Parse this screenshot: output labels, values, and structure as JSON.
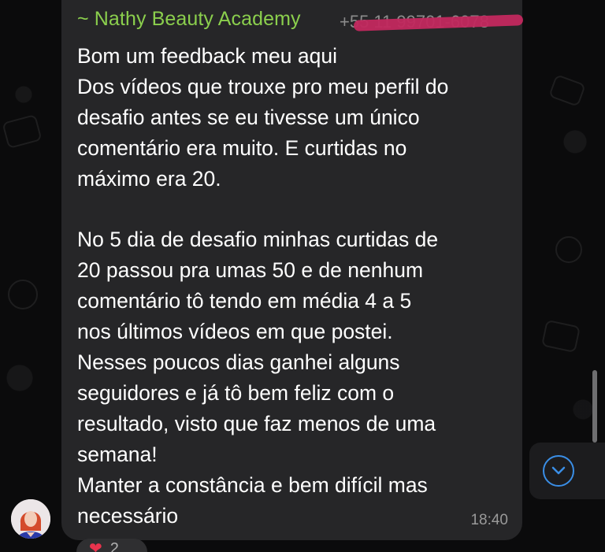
{
  "message": {
    "sender_name": "~ Nathy Beauty Academy",
    "sender_phone": "+55 11 99701-6078",
    "lines": [
      "Bom um feedback meu aqui",
      "Dos vídeos que trouxe pro meu perfil do",
      "desafio antes se eu tivesse um único",
      "comentário era muito. E curtidas no",
      "máximo era 20.",
      "",
      "No 5 dia de desafio minhas curtidas de",
      "20 passou pra umas 50 e de nenhum",
      "comentário tô tendo em média 4 a 5",
      "nos últimos vídeos em que postei.",
      "Nesses poucos dias ganhei alguns",
      "seguidores e já tô bem feliz com o",
      "resultado, visto que faz menos de uma",
      "semana!",
      "Manter a constância e bem difícil mas",
      "necessário"
    ],
    "time": "18:40"
  },
  "reaction": {
    "emoji": "❤",
    "count": "2"
  },
  "colors": {
    "background": "#0b0b0c",
    "bubble": "#262628",
    "sender": "#8bcf4d",
    "redaction": "#c2285e",
    "accent": "#3a8ee6"
  },
  "icons": {
    "scroll_down": "chevron-down-circle-icon"
  }
}
